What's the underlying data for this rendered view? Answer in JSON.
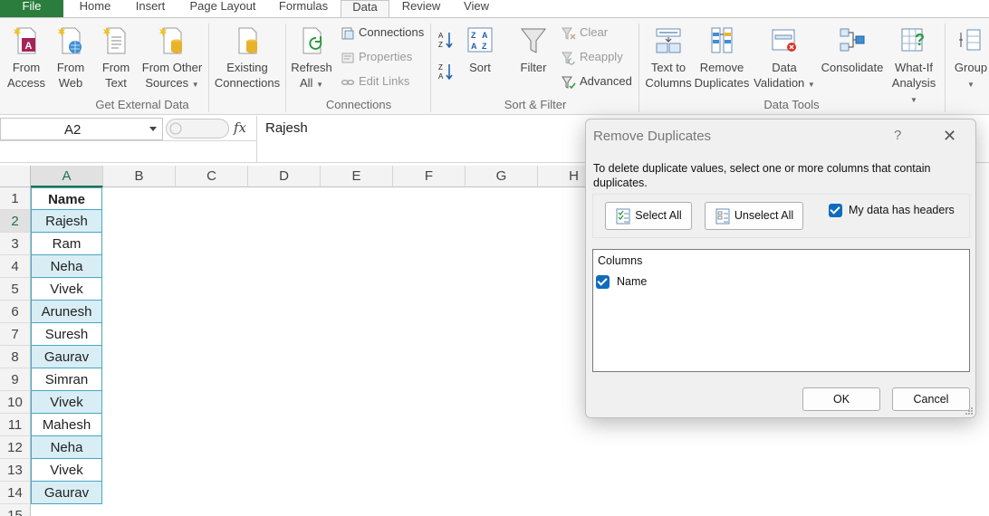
{
  "tabs": [
    "File",
    "Home",
    "Insert",
    "Page Layout",
    "Formulas",
    "Data",
    "Review",
    "View"
  ],
  "active_tab": "Data",
  "ribbon": {
    "get_external_data": {
      "label": "Get External Data",
      "from_access": [
        "From",
        "Access"
      ],
      "from_web": [
        "From",
        "Web"
      ],
      "from_text": [
        "From",
        "Text"
      ],
      "from_other": [
        "From Other",
        "Sources"
      ],
      "existing": [
        "Existing",
        "Connections"
      ]
    },
    "connections": {
      "label": "Connections",
      "refresh": [
        "Refresh",
        "All"
      ],
      "connections": "Connections",
      "properties": "Properties",
      "edit_links": "Edit Links"
    },
    "sort_filter": {
      "label": "Sort & Filter",
      "sort": "Sort",
      "filter": "Filter",
      "clear": "Clear",
      "reapply": "Reapply",
      "advanced": "Advanced"
    },
    "data_tools": {
      "label": "Data Tools",
      "text_to_columns": [
        "Text to",
        "Columns"
      ],
      "remove_duplicates": [
        "Remove",
        "Duplicates"
      ],
      "data_validation": [
        "Data",
        "Validation"
      ],
      "consolidate": "Consolidate",
      "what_if": [
        "What-If",
        "Analysis"
      ]
    },
    "outline": {
      "group": "Group"
    }
  },
  "formula_bar": {
    "name_box": "A2",
    "fx": "fx",
    "value": "Rajesh"
  },
  "sheet": {
    "columns": [
      "A",
      "B",
      "C",
      "D",
      "E",
      "F",
      "G",
      "H"
    ],
    "rows": [
      "1",
      "2",
      "3",
      "4",
      "5",
      "6",
      "7",
      "8",
      "9",
      "10",
      "11",
      "12",
      "13",
      "14",
      "15"
    ],
    "column_a": [
      "Name",
      "Rajesh",
      "Ram",
      "Neha",
      "Vivek",
      "Arunesh",
      "Suresh",
      "Gaurav",
      "Simran",
      "Vivek",
      "Mahesh",
      "Neha",
      "Vivek",
      "Gaurav"
    ]
  },
  "dialog": {
    "title": "Remove Duplicates",
    "help": "?",
    "close": "✕",
    "description": "To delete duplicate values, select one or more columns that contain duplicates.",
    "select_all": "Select All",
    "unselect_all": "Unselect All",
    "my_data_has_headers": "My data has headers",
    "columns_header": "Columns",
    "columns": [
      {
        "name": "Name",
        "checked": true
      }
    ],
    "ok": "OK",
    "cancel": "Cancel"
  },
  "colors": {
    "file_tab": "#2a7d3c",
    "accent": "#217346",
    "table_border": "#47a6c5",
    "table_band": "#d8edf4",
    "checkbox": "#0f6cbd"
  }
}
